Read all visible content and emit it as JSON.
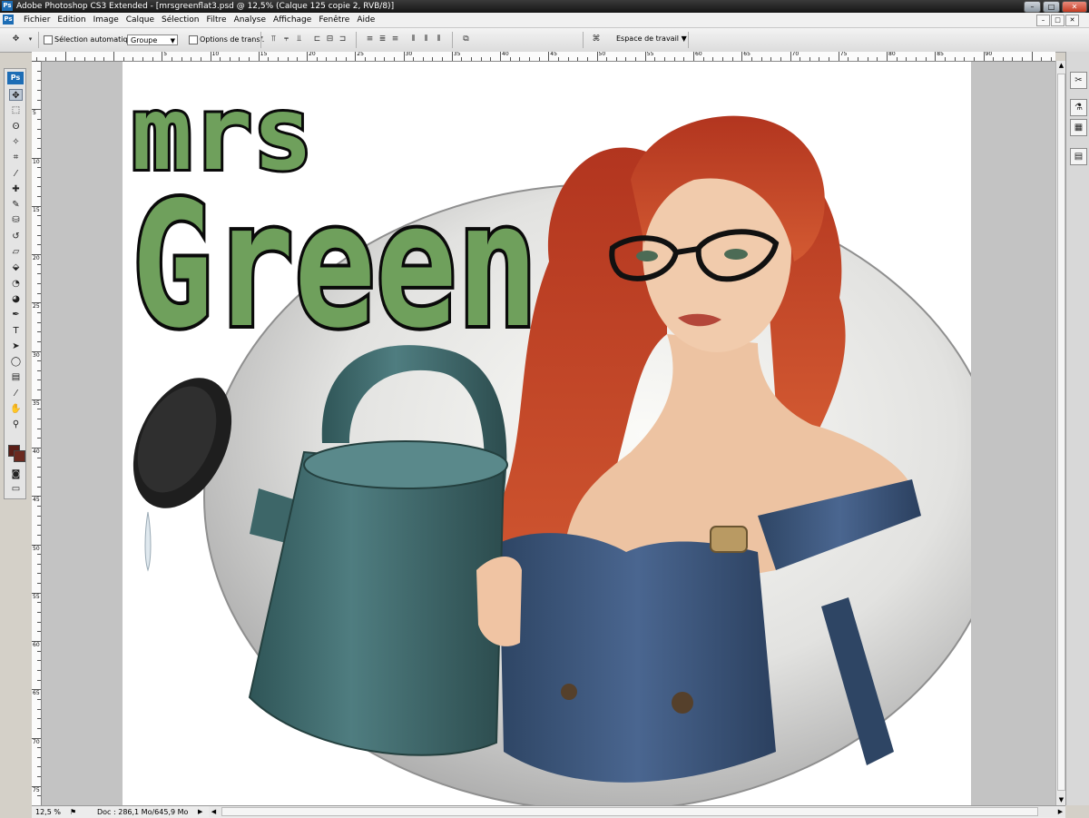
{
  "window": {
    "app_icon": "Ps",
    "title": "Adobe Photoshop CS3 Extended - [mrsgreenflat3.psd @ 12,5% (Calque 125 copie 2, RVB/8)]",
    "minimize": "–",
    "maximize": "□",
    "close": "✕"
  },
  "menu": {
    "items": [
      "Fichier",
      "Edition",
      "Image",
      "Calque",
      "Sélection",
      "Filtre",
      "Analyse",
      "Affichage",
      "Fenêtre",
      "Aide"
    ]
  },
  "options_bar": {
    "auto_select_label": "Sélection automatique :",
    "auto_select_value": "Groupe",
    "transform_label": "Options de transf.",
    "workspace_label": "Espace de travail"
  },
  "tools": {
    "logo": "Ps",
    "icons": [
      "move-icon",
      "marquee-icon",
      "lasso-icon",
      "magic-wand-icon",
      "crop-icon",
      "eyedropper-icon",
      "healing-brush-icon",
      "brush-icon",
      "clone-stamp-icon",
      "history-brush-icon",
      "eraser-icon",
      "paint-bucket-icon",
      "blur-icon",
      "dodge-icon",
      "pen-icon",
      "type-icon",
      "path-selection-icon",
      "shape-icon",
      "notes-icon",
      "eyedropper-2-icon",
      "hand-icon",
      "zoom-icon"
    ],
    "glyphs": [
      "✥",
      "⬚",
      "ʘ",
      "✧",
      "⌗",
      "⁄",
      "✚",
      "✎",
      "⛁",
      "↺",
      "▱",
      "⬙",
      "◔",
      "◕",
      "✒",
      "T",
      "➤",
      "◯",
      "▤",
      "⁄",
      "✋",
      "⚲"
    ],
    "foreground_color": "#5a1e17",
    "background_color": "#6b2a20"
  },
  "rulers": {
    "top_labels": [
      "5",
      "10",
      "15",
      "20",
      "25",
      "30",
      "35",
      "40",
      "45",
      "50",
      "55",
      "60",
      "65",
      "70",
      "75",
      "80",
      "85",
      "90"
    ],
    "left_labels": [
      "5",
      "10",
      "15",
      "20",
      "25",
      "30",
      "35",
      "40",
      "45",
      "50",
      "55",
      "60",
      "65",
      "70",
      "75"
    ]
  },
  "artwork": {
    "line1": "mrs",
    "line2": "Green",
    "text_color": "#6fa05c",
    "outline_color": "#0a0a0a",
    "hair_color": "#c9442a",
    "can_color": "#3f6b6e",
    "denim_color": "#3a5478",
    "skin_color": "#f0c8aa"
  },
  "status": {
    "zoom": "12,5 %",
    "doc_info": "Doc : 286,1 Mo/645,9 Mo"
  },
  "dock": {
    "icons": [
      "tools-dock-icon",
      "brushes-dock-icon",
      "clone-dock-icon",
      "layers-dock-icon"
    ],
    "glyphs": [
      "✂",
      "⚗",
      "▦",
      "▤"
    ]
  }
}
